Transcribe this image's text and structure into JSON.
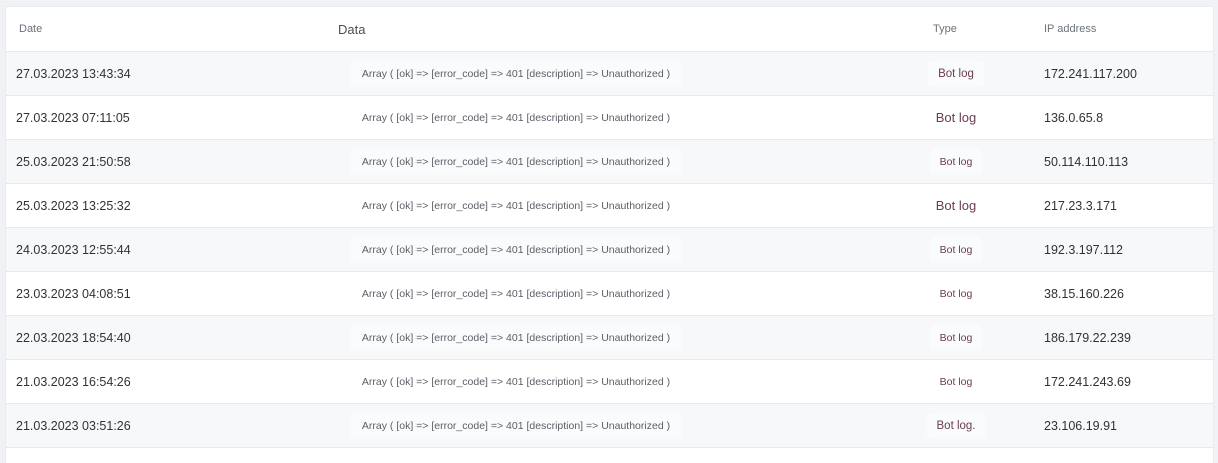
{
  "table": {
    "headers": {
      "date": "Date",
      "data": "Data",
      "type": "Type",
      "ip": "IP address"
    },
    "rows": [
      {
        "date": "27.03.2023 13:43:34",
        "data": "Array ( [ok] => [error_code] => 401 [description] => Unauthorized )",
        "type": "Bot log",
        "ip": "172.241.117.200"
      },
      {
        "date": "27.03.2023 07:11:05",
        "data": "Array ( [ok] => [error_code] => 401 [description] => Unauthorized )",
        "type": "Bot log",
        "ip": "136.0.65.8"
      },
      {
        "date": "25.03.2023 21:50:58",
        "data": "Array ( [ok] => [error_code] => 401 [description] => Unauthorized )",
        "type": "Bot log",
        "ip": "50.114.110.113"
      },
      {
        "date": "25.03.2023 13:25:32",
        "data": "Array ( [ok] => [error_code] => 401 [description] => Unauthorized )",
        "type": "Bot log",
        "ip": "217.23.3.171"
      },
      {
        "date": "24.03.2023 12:55:44",
        "data": "Array ( [ok] => [error_code] => 401 [description] => Unauthorized )",
        "type": "Bot log",
        "ip": "192.3.197.112"
      },
      {
        "date": "23.03.2023 04:08:51",
        "data": "Array ( [ok] => [error_code] => 401 [description] => Unauthorized )",
        "type": "Bot log",
        "ip": "38.15.160.226"
      },
      {
        "date": "22.03.2023 18:54:40",
        "data": "Array ( [ok] => [error_code] => 401 [description] => Unauthorized )",
        "type": "Bot log",
        "ip": "186.179.22.239"
      },
      {
        "date": "21.03.2023 16:54:26",
        "data": "Array ( [ok] => [error_code] => 401 [description] => Unauthorized )",
        "type": "Bot log",
        "ip": "172.241.243.69"
      },
      {
        "date": "21.03.2023 03:51:26",
        "data": "Array ( [ok] => [error_code] => 401 [description] => Unauthorized )",
        "type": "Bot log.",
        "ip": "23.106.19.91"
      }
    ]
  }
}
